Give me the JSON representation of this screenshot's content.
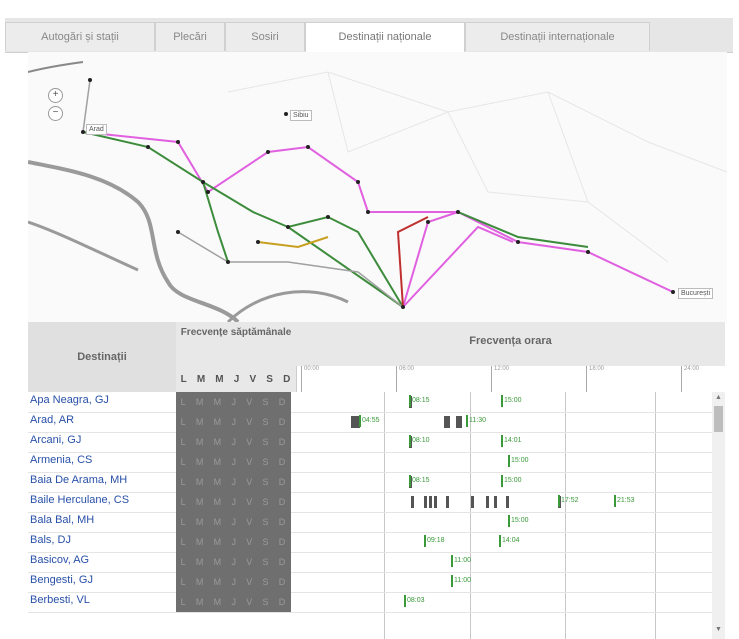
{
  "tabs": [
    {
      "label": "Autogări și stații",
      "active": false
    },
    {
      "label": "Plecări",
      "active": false
    },
    {
      "label": "Sosiri",
      "active": false
    },
    {
      "label": "Destinații naționale",
      "active": true
    },
    {
      "label": "Destinații internaționale",
      "active": false
    }
  ],
  "map": {
    "zoom_in": "+",
    "zoom_out": "−",
    "labels": [
      "Arad",
      "Sibiu",
      "București"
    ]
  },
  "table": {
    "col_destination": "Destinații",
    "col_weekly": "Frecvențe săptămânale",
    "col_hourly": "Frecvența orara",
    "days": [
      "L",
      "M",
      "M",
      "J",
      "V",
      "S",
      "D"
    ],
    "hours": [
      "00:00",
      "06:00",
      "12:00",
      "18:00",
      "24:00"
    ],
    "rows": [
      {
        "name": "Apa Neagra, GJ",
        "times": [
          "08:15",
          "15:00"
        ]
      },
      {
        "name": "Arad, AR",
        "times": [
          "04:55",
          "11:30"
        ]
      },
      {
        "name": "Arcani, GJ",
        "times": [
          "08:10",
          "14:01"
        ]
      },
      {
        "name": "Armenia, CS",
        "times": [
          "15:00"
        ]
      },
      {
        "name": "Baia De Arama, MH",
        "times": [
          "08:15",
          "15:00"
        ]
      },
      {
        "name": "Baile Herculane, CS",
        "times": [
          "17:52",
          "21:53"
        ]
      },
      {
        "name": "Bala Bal, MH",
        "times": [
          "15:00"
        ]
      },
      {
        "name": "Bals, DJ",
        "times": [
          "09:18",
          "14:04"
        ]
      },
      {
        "name": "Basicov, AG",
        "times": [
          "11:00"
        ]
      },
      {
        "name": "Bengesti, GJ",
        "times": [
          "11:00"
        ]
      },
      {
        "name": "Berbesti, VL",
        "times": [
          "08:03"
        ]
      }
    ]
  },
  "colors": {
    "link": "#2850a8",
    "day_bg": "#6f6f6f",
    "time_green": "#3a9a3a",
    "route_pink": "#e060e0",
    "route_green": "#3c8c3c",
    "route_red": "#c03030"
  }
}
